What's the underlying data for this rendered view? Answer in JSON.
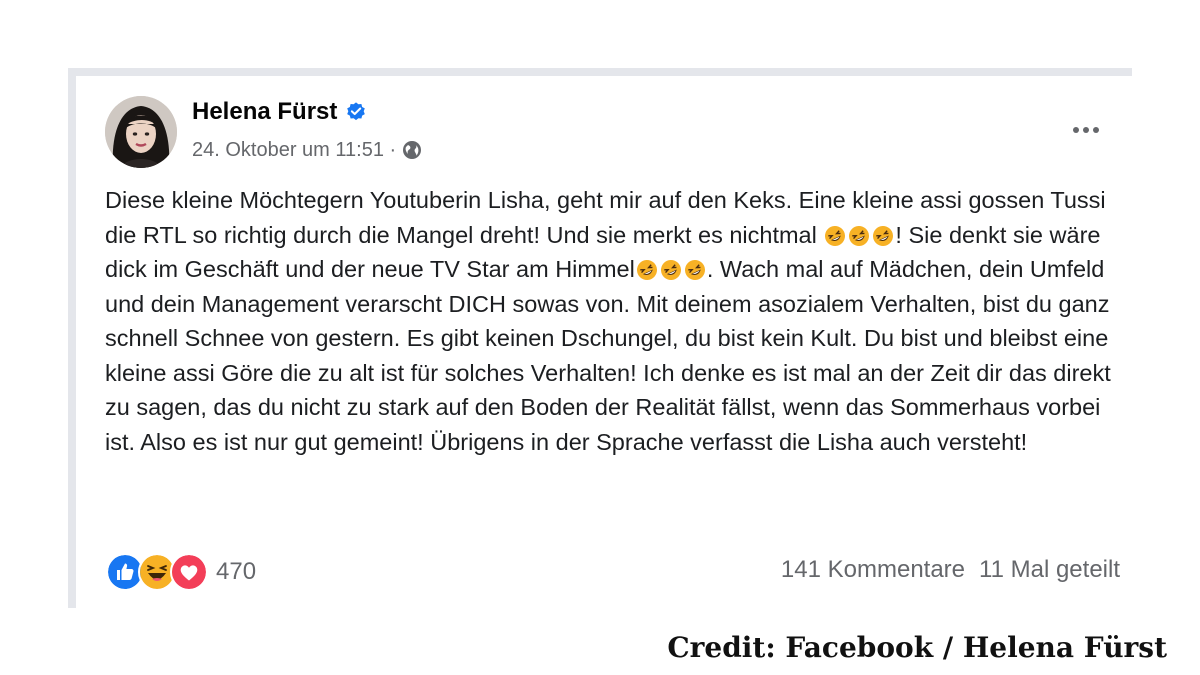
{
  "post": {
    "author": "Helena Fürst",
    "verified_icon": "verified-badge-icon",
    "date": "24. Oktober um 11:51 ·",
    "privacy_icon": "globe-icon",
    "more_icon": "more-options-icon",
    "text_segments": [
      "Diese kleine Möchtegern Youtuberin Lisha, geht mir auf den Keks. Eine kleine assi gossen Tussi die RTL so richtig durch die Mangel dreht! Und sie merkt es nichtmal ",
      "! Sie denkt sie wäre dick im Geschäft und der neue TV Star am Himmel",
      ". Wach mal auf Mädchen, dein Umfeld und dein Management verarscht DICH sowas von. Mit deinem asozialem Verhalten, bist du ganz schnell Schnee von gestern. Es gibt keinen Dschungel, du bist kein Kult. Du bist und bleibst eine kleine assi Göre die zu alt ist für solches Verhalten! Ich denke es ist mal an der Zeit dir das direkt zu sagen, das du nicht zu stark auf den Boden der Realität fällst, wenn das Sommerhaus vorbei ist. Also es ist nur gut gemeint! Übrigens in der Sprache verfasst die Lisha auch versteht!"
    ],
    "inline_emoji": "rolling-on-floor-laughing-emoji"
  },
  "engagement": {
    "reactions": [
      "like-reaction-icon",
      "haha-reaction-icon",
      "love-reaction-icon"
    ],
    "reaction_count": "470",
    "comments": "141 Kommentare",
    "shares": "11 Mal geteilt"
  },
  "credit": "Credit: Facebook / Helena Fürst",
  "colors": {
    "facebook_blue": "#1877f2",
    "text": "#1c1e21",
    "secondary_text": "#65676b",
    "love_red": "#f33e58",
    "haha_yellow": "#f7b125"
  }
}
